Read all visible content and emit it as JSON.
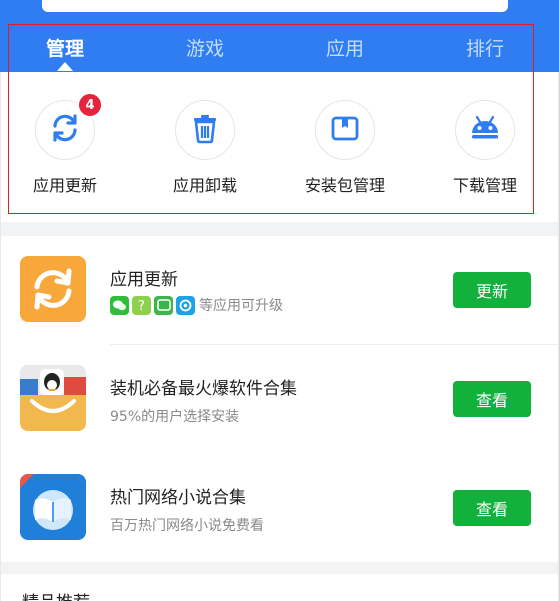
{
  "tabs": [
    {
      "label": "管理",
      "active": true
    },
    {
      "label": "游戏",
      "active": false
    },
    {
      "label": "应用",
      "active": false
    },
    {
      "label": "排行",
      "active": false
    }
  ],
  "quick_actions": [
    {
      "label": "应用更新",
      "icon": "refresh-icon",
      "badge": "4"
    },
    {
      "label": "应用卸载",
      "icon": "trash-icon"
    },
    {
      "label": "安装包管理",
      "icon": "package-icon"
    },
    {
      "label": "下载管理",
      "icon": "android-icon"
    }
  ],
  "list": [
    {
      "title": "应用更新",
      "subtitle": "等应用可升级",
      "button": "更新",
      "icon": "update-app-icon"
    },
    {
      "title": "装机必备最火爆软件合集",
      "subtitle": "95%的用户选择安装",
      "button": "查看",
      "icon": "essential-apps-icon"
    },
    {
      "title": "热门网络小说合集",
      "subtitle": "百万热门网络小说免费看",
      "button": "查看",
      "icon": "novel-book-icon"
    }
  ],
  "section": {
    "title": "精品推荐"
  },
  "colors": {
    "primary": "#2f7df1",
    "button": "#11b13c",
    "badge": "#e5243b",
    "highlight": "#e02020"
  }
}
